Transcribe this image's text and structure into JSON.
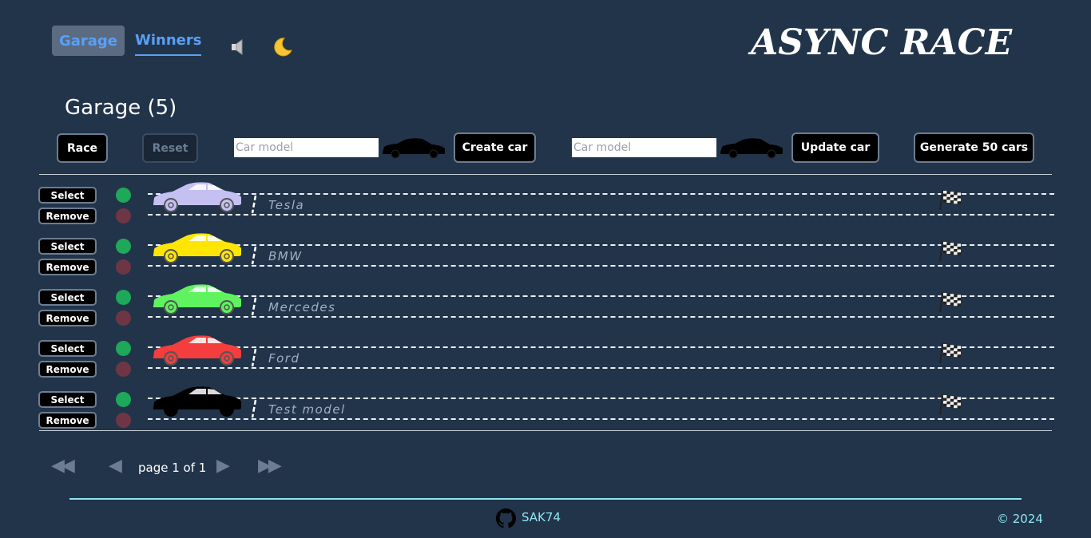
{
  "nav": {
    "garage_label": "Garage",
    "winners_label": "Winners"
  },
  "header": {
    "logo": "ASYNC RACE",
    "sound_icon": "speaker-icon",
    "theme_icon": "moon-icon"
  },
  "garage": {
    "title": "Garage (5)"
  },
  "controls": {
    "race_label": "Race",
    "reset_label": "Reset",
    "create": {
      "placeholder": "Car model",
      "value": "",
      "color": "#000000",
      "button_label": "Create car"
    },
    "update": {
      "placeholder": "Car model",
      "value": "",
      "color": "#000000",
      "button_label": "Update car"
    },
    "generate_label": "Generate 50 cars"
  },
  "cars": [
    {
      "name": "Tesla",
      "color": "#c4c0f2",
      "select_label": "Select",
      "remove_label": "Remove"
    },
    {
      "name": "BMW",
      "color": "#ffe600",
      "select_label": "Select",
      "remove_label": "Remove"
    },
    {
      "name": "Mercedes",
      "color": "#5ff35f",
      "select_label": "Select",
      "remove_label": "Remove"
    },
    {
      "name": "Ford",
      "color": "#f43d3d",
      "select_label": "Select",
      "remove_label": "Remove"
    },
    {
      "name": "Test model",
      "color": "#000000",
      "select_label": "Select",
      "remove_label": "Remove"
    }
  ],
  "pagination": {
    "first_label": "◀◀",
    "prev_label": "◀",
    "page_label": "page 1 of 1",
    "next_label": "▶",
    "last_label": "▶▶"
  },
  "footer": {
    "github_user": "SAK74",
    "copyright": "© 2024"
  },
  "colors": {
    "background": "#22344a",
    "accent": "#5aa0f5",
    "footer_accent": "#8fe6f0"
  }
}
